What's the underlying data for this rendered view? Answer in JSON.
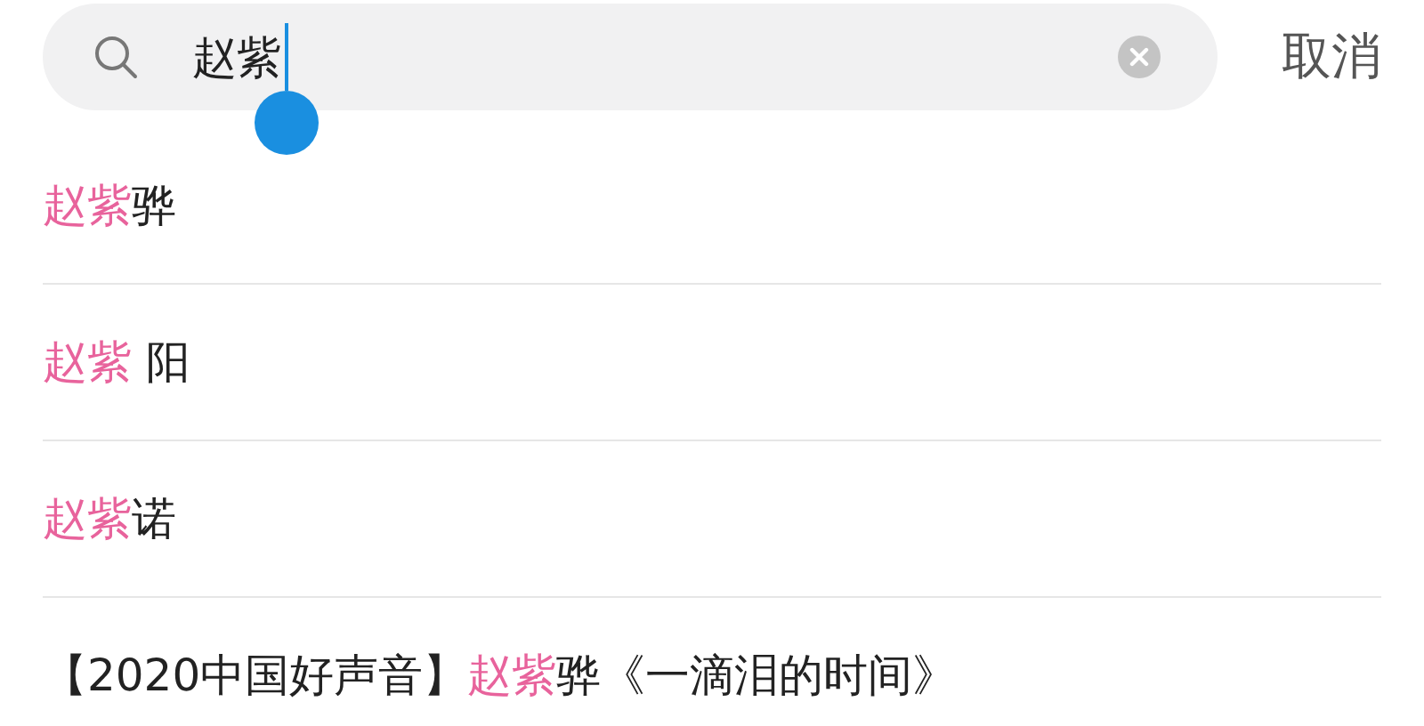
{
  "search": {
    "value": "赵紫",
    "focused": true
  },
  "cancel": "取消",
  "suggestions": [
    {
      "segments": [
        {
          "text": "赵紫",
          "highlight": true
        },
        {
          "text": "骅",
          "highlight": false
        }
      ]
    },
    {
      "segments": [
        {
          "text": "赵紫",
          "highlight": true
        },
        {
          "text": " 阳",
          "highlight": false
        }
      ]
    },
    {
      "segments": [
        {
          "text": "赵紫",
          "highlight": true
        },
        {
          "text": "诺",
          "highlight": false
        }
      ]
    },
    {
      "segments": [
        {
          "text": "【2020中国好声音】",
          "highlight": false
        },
        {
          "text": "赵紫",
          "highlight": true
        },
        {
          "text": "骅《一滴泪的时间》",
          "highlight": false
        }
      ]
    }
  ]
}
